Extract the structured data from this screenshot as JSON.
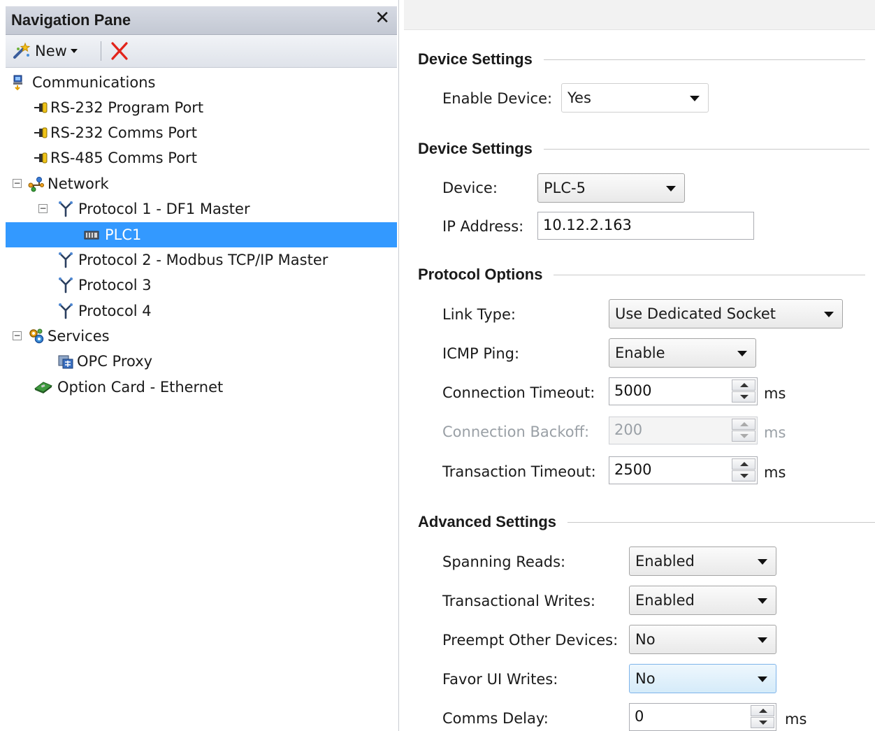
{
  "nav": {
    "title": "Navigation Pane",
    "close_glyph": "✕",
    "toolbar": {
      "new_label": "New"
    },
    "tree": [
      {
        "label": "Communications",
        "icon": "computer-comms-icon"
      },
      {
        "label": "RS-232 Program Port",
        "icon": "serial-port-icon"
      },
      {
        "label": "RS-232 Comms Port",
        "icon": "serial-port-icon"
      },
      {
        "label": "RS-485 Comms Port",
        "icon": "serial-port-icon"
      },
      {
        "label": "Network",
        "icon": "network-icon",
        "expander": "−"
      },
      {
        "label": "Protocol 1 - DF1 Master",
        "icon": "protocol-icon",
        "expander": "−"
      },
      {
        "label": "PLC1",
        "icon": "plc-icon",
        "selected": true
      },
      {
        "label": "Protocol 2 - Modbus TCP/IP Master",
        "icon": "protocol-icon"
      },
      {
        "label": "Protocol 3",
        "icon": "protocol-icon"
      },
      {
        "label": "Protocol 4",
        "icon": "protocol-icon"
      },
      {
        "label": "Services",
        "icon": "services-icon",
        "expander": "−"
      },
      {
        "label": "OPC Proxy",
        "icon": "opc-proxy-icon"
      },
      {
        "label": "Option Card - Ethernet",
        "icon": "option-card-icon"
      }
    ]
  },
  "props": {
    "sections": {
      "device_settings_1": "Device Settings",
      "device_settings_2": "Device Settings",
      "protocol_options": "Protocol Options",
      "advanced_settings": "Advanced Settings"
    },
    "enable_device": {
      "label": "Enable Device:",
      "value": "Yes"
    },
    "device": {
      "label": "Device:",
      "value": "PLC-5"
    },
    "ip_address": {
      "label": "IP Address:",
      "value": "10.12.2.163"
    },
    "link_type": {
      "label": "Link Type:",
      "value": "Use Dedicated Socket"
    },
    "icmp_ping": {
      "label": "ICMP Ping:",
      "value": "Enable"
    },
    "connection_timeout": {
      "label": "Connection Timeout:",
      "value": "5000",
      "unit": "ms"
    },
    "connection_backoff": {
      "label": "Connection Backoff:",
      "value": "200",
      "unit": "ms"
    },
    "transaction_timeout": {
      "label": "Transaction Timeout:",
      "value": "2500",
      "unit": "ms"
    },
    "spanning_reads": {
      "label": "Spanning Reads:",
      "value": "Enabled"
    },
    "transactional_writes": {
      "label": "Transactional Writes:",
      "value": "Enabled"
    },
    "preempt_other_devices": {
      "label": "Preempt Other Devices:",
      "value": "No"
    },
    "favor_ui_writes": {
      "label": "Favor UI Writes:",
      "value": "No"
    },
    "comms_delay": {
      "label": "Comms Delay:",
      "value": "0",
      "unit": "ms"
    }
  }
}
